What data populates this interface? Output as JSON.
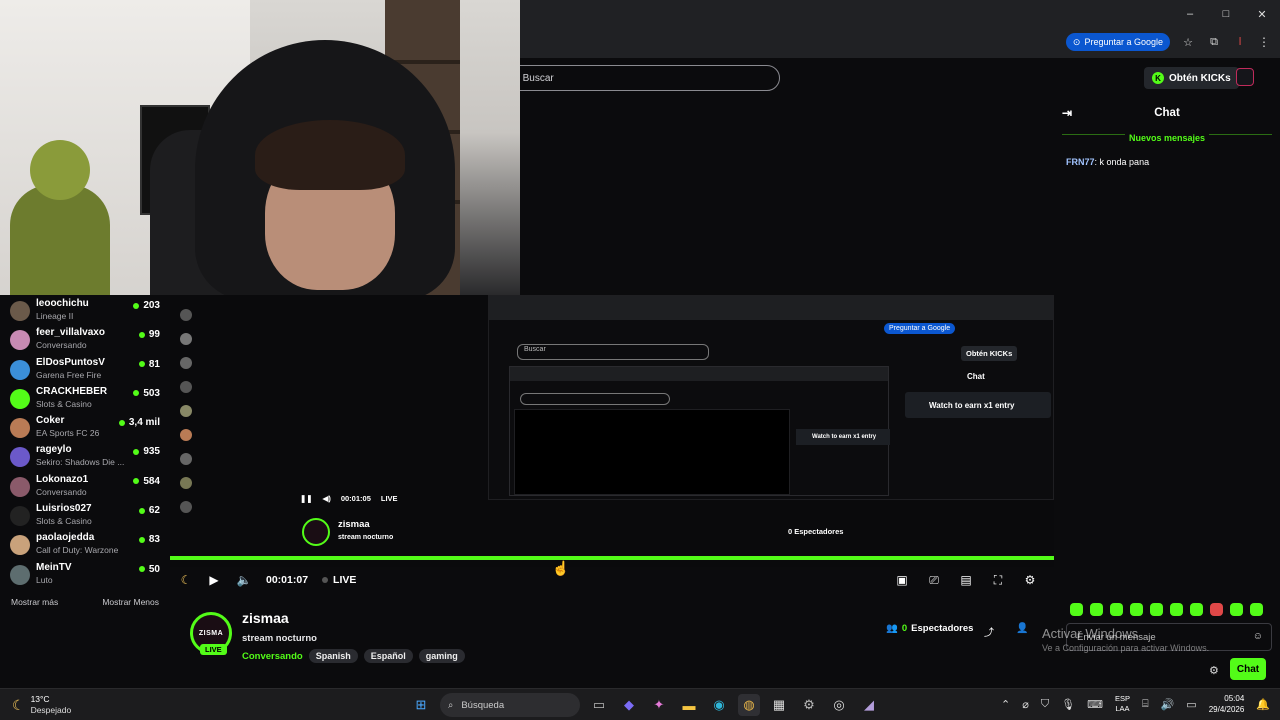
{
  "browser": {
    "google_button": "Preguntar a Google",
    "window_controls": [
      "–",
      "□",
      "✕"
    ]
  },
  "site": {
    "search_placeholder": "Buscar",
    "kicks_button": "Obtén KICKs"
  },
  "following": {
    "items": [
      {
        "name": "leoochichu",
        "category": "Lineage II",
        "viewers": "203",
        "avatar_color": "#6b5a4a"
      },
      {
        "name": "feer_villalvaxo",
        "category": "Conversando",
        "viewers": "99",
        "avatar_color": "#c88ab3"
      },
      {
        "name": "ElDosPuntosV",
        "category": "Garena Free Fire",
        "viewers": "81",
        "avatar_color": "#3b8fd9"
      },
      {
        "name": "CRACKHEBER",
        "category": "Slots & Casino",
        "viewers": "503",
        "avatar_color": "#53fc18"
      },
      {
        "name": "Coker",
        "category": "EA Sports FC 26",
        "viewers": "3,4 mil",
        "avatar_color": "#b97b55"
      },
      {
        "name": "rageylo",
        "category": "Sekiro: Shadows Die ...",
        "viewers": "935",
        "avatar_color": "#6b59c9"
      },
      {
        "name": "Lokonazo1",
        "category": "Conversando",
        "viewers": "584",
        "avatar_color": "#8a5a6a"
      },
      {
        "name": "Luisrios027",
        "category": "Slots & Casino",
        "viewers": "62",
        "avatar_color": "#222"
      },
      {
        "name": "paolaojedda",
        "category": "Call of Duty: Warzone",
        "viewers": "83",
        "avatar_color": "#c9a27b"
      },
      {
        "name": "MeinTV",
        "category": "Luto",
        "viewers": "50",
        "avatar_color": "#5d6d6f"
      }
    ],
    "show_more": "Mostrar más",
    "show_less": "Mostrar Menos"
  },
  "player": {
    "time": "00:01:07",
    "live_label": "LIVE"
  },
  "channel": {
    "avatar_text": "ZISMA",
    "live_badge": "LIVE",
    "name": "zismaa",
    "title": "stream nocturno",
    "category": "Conversando",
    "tags": [
      "Spanish",
      "Español",
      "gaming"
    ],
    "viewers_count": "0",
    "viewers_label": "Espectadores"
  },
  "chat": {
    "title": "Chat",
    "new_messages": "Nuevos mensajes",
    "messages": [
      {
        "user": "FRN77",
        "text": "k onda pana"
      }
    ],
    "input_placeholder": "Enviar un mensaje",
    "send_button": "Chat"
  },
  "watermark": {
    "title": "Activar Windows",
    "subtitle": "Ve a Configuración para activar Windows."
  },
  "nested": {
    "watch_entry": "Watch to earn x1 entry",
    "chat_title": "Chat",
    "kicks": "Obtén KICKs",
    "search": "Buscar",
    "google": "Preguntar a Google",
    "time": "00:01:05",
    "live": "LIVE",
    "name": "zismaa",
    "title": "stream nocturno",
    "viewers": "0 Espectadores"
  },
  "taskbar": {
    "temp": "13°C",
    "weather": "Despejado",
    "search_label": "Búsqueda",
    "lang_top": "ESP",
    "lang_bottom": "LAA",
    "time": "05:04",
    "date": "29/4/2026"
  },
  "colors": {
    "accent": "#53fc18",
    "background": "#0b0b0d"
  }
}
